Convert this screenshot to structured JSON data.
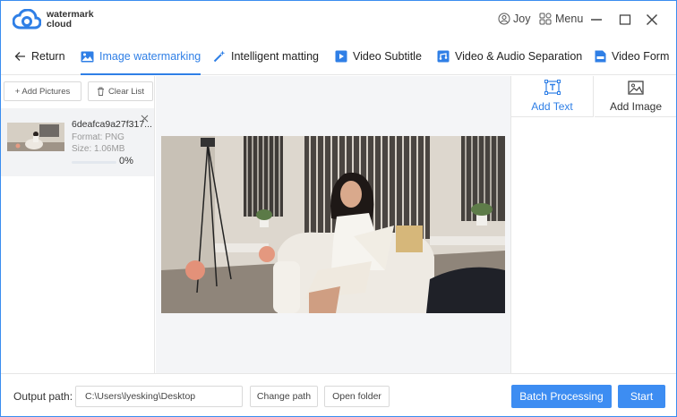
{
  "app": {
    "logo_line1": "watermark",
    "logo_line2": "cloud",
    "username": "Joy",
    "menu_label": "Menu"
  },
  "tabs": [
    {
      "label": "Return",
      "icon": "arrow-left-icon"
    },
    {
      "label": "Image watermarking",
      "icon": "image-icon",
      "active": true
    },
    {
      "label": "Intelligent matting",
      "icon": "magic-wand-icon"
    },
    {
      "label": "Video Subtitle",
      "icon": "video-subtitle-icon"
    },
    {
      "label": "Video & Audio Separation",
      "icon": "video-audio-icon"
    },
    {
      "label": "Video Form",
      "icon": "video-format-icon"
    }
  ],
  "left_panel": {
    "add_pictures": "+ Add Pictures",
    "clear_list": "Clear List",
    "file": {
      "name": "6deafca9a27f317...",
      "format": "Format:  PNG",
      "size": "Size:  1.06MB",
      "progress_percent": 0,
      "progress_label": "0%"
    }
  },
  "right_panel": {
    "add_text": "Add Text",
    "add_image": "Add Image"
  },
  "footer": {
    "output_label": "Output path:",
    "output_path": "C:\\Users\\lyesking\\Desktop",
    "change_path": "Change path",
    "open_folder": "Open folder",
    "batch_processing": "Batch Processing",
    "start": "Start"
  },
  "colors": {
    "accent": "#2f7fe6",
    "primary_button": "#3d8df2"
  }
}
